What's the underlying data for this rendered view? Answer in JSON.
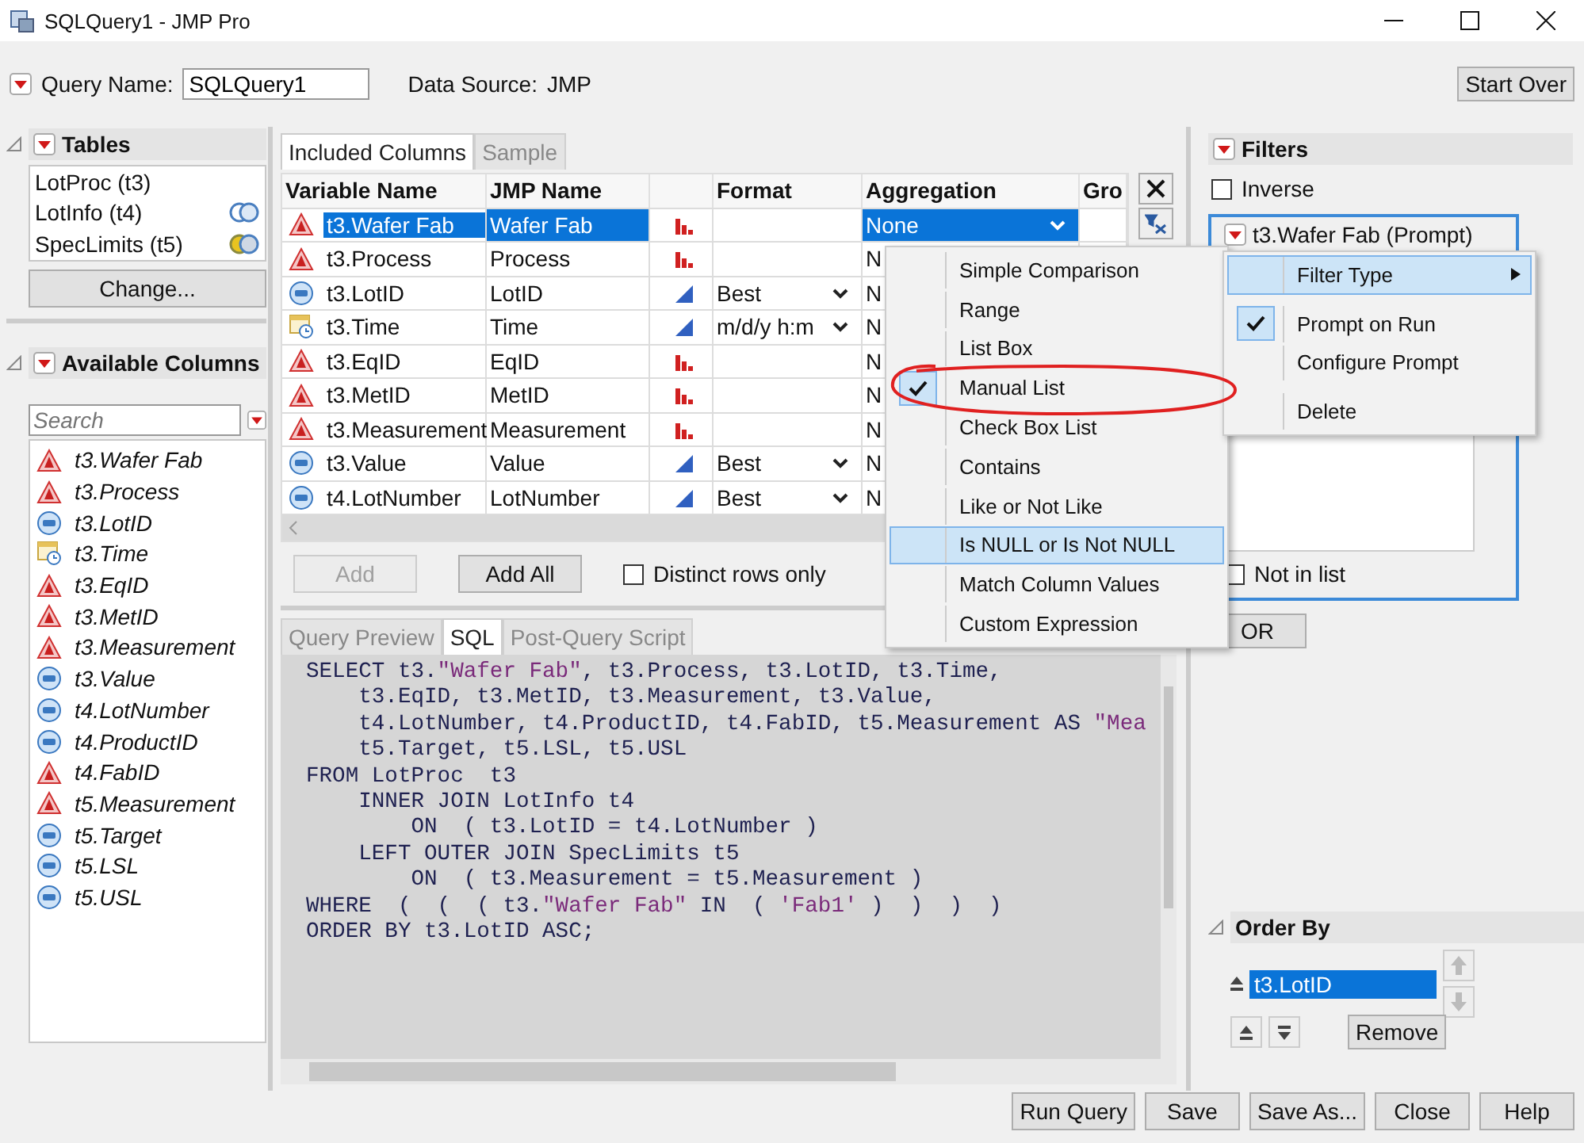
{
  "window": {
    "title": "SQLQuery1 - JMP Pro"
  },
  "query_name": {
    "label": "Query Name:",
    "value": "SQLQuery1"
  },
  "data_source": {
    "label": "Data Source:",
    "value": "JMP"
  },
  "start_over": "Start Over",
  "tables": {
    "title": "Tables",
    "items": [
      {
        "name": "LotProc (t3)",
        "kind": "base"
      },
      {
        "name": "LotInfo (t4)",
        "kind": "inner"
      },
      {
        "name": "SpecLimits (t5)",
        "kind": "outer"
      }
    ],
    "button": "Change..."
  },
  "available_columns": {
    "title": "Available Columns",
    "search_placeholder": "Search",
    "items": [
      {
        "name": "t3.Wafer Fab",
        "kind": "character"
      },
      {
        "name": "t3.Process",
        "kind": "character"
      },
      {
        "name": "t3.LotID",
        "kind": "numeric"
      },
      {
        "name": "t3.Time",
        "kind": "time"
      },
      {
        "name": "t3.EqID",
        "kind": "character"
      },
      {
        "name": "t3.MetID",
        "kind": "character"
      },
      {
        "name": "t3.Measurement",
        "kind": "character"
      },
      {
        "name": "t3.Value",
        "kind": "numeric"
      },
      {
        "name": "t4.LotNumber",
        "kind": "numeric"
      },
      {
        "name": "t4.ProductID",
        "kind": "numeric"
      },
      {
        "name": "t4.FabID",
        "kind": "character"
      },
      {
        "name": "t5.Measurement",
        "kind": "character"
      },
      {
        "name": "t5.Target",
        "kind": "numeric"
      },
      {
        "name": "t5.LSL",
        "kind": "numeric"
      },
      {
        "name": "t5.USL",
        "kind": "numeric"
      }
    ]
  },
  "included_tabs": [
    {
      "label": "Included Columns",
      "selected": true
    },
    {
      "label": "Sample",
      "selected": false
    }
  ],
  "table": {
    "headers": {
      "variable_name": "Variable Name",
      "jmp_name": "JMP Name",
      "format": "Format",
      "aggregation": "Aggregation",
      "column_6": "Gro"
    },
    "rows": [
      {
        "variable": "t3.Wafer Fab",
        "kind": "character",
        "jmp_name": "Wafer Fab",
        "aggregation": "None",
        "selected": true
      },
      {
        "variable": "t3.Process",
        "kind": "character",
        "jmp_name": "Process",
        "aggregation": "N",
        "selected": false
      },
      {
        "variable": "t3.LotID",
        "kind": "numeric",
        "jmp_name": "LotID",
        "format": "Best",
        "aggregation": "N",
        "selected": false
      },
      {
        "variable": "t3.Time",
        "kind": "time",
        "jmp_name": "Time",
        "format": "m/d/y h:m",
        "aggregation": "N",
        "selected": false
      },
      {
        "variable": "t3.EqID",
        "kind": "character",
        "jmp_name": "EqID",
        "aggregation": "N",
        "selected": false
      },
      {
        "variable": "t3.MetID",
        "kind": "character",
        "jmp_name": "MetID",
        "aggregation": "N",
        "selected": false
      },
      {
        "variable": "t3.Measurement",
        "kind": "character",
        "jmp_name": "Measurement",
        "aggregation": "N",
        "selected": false
      },
      {
        "variable": "t3.Value",
        "kind": "numeric",
        "jmp_name": "Value",
        "format": "Best",
        "aggregation": "N",
        "selected": false
      },
      {
        "variable": "t4.LotNumber",
        "kind": "numeric",
        "jmp_name": "LotNumber",
        "format": "Best",
        "aggregation": "N",
        "selected": false
      }
    ]
  },
  "add_buttons": [
    {
      "label": "Add",
      "disabled": true
    },
    {
      "label": "Add All",
      "disabled": false
    }
  ],
  "distinct_rows": {
    "label": "Distinct rows only",
    "checked": false
  },
  "preview_tabs": [
    {
      "label": "Query Preview",
      "selected": false
    },
    {
      "label": "SQL",
      "selected": true
    },
    {
      "label": "Post-Query Script",
      "selected": false
    }
  ],
  "sql": [
    [
      {
        "text": "SELECT t3.",
        "kind": "code"
      },
      {
        "text": "\"Wafer Fab\"",
        "kind": "string"
      },
      {
        "text": ", t3.Process, t3.LotID, t3.Time,",
        "kind": "code"
      }
    ],
    [
      {
        "text": "    t3.EqID, t3.MetID, t3.Measurement, t3.Value,",
        "kind": "code"
      }
    ],
    [
      {
        "text": "    t4.LotNumber, t4.ProductID, t4.FabID, t5.Measurement AS ",
        "kind": "code"
      },
      {
        "text": "\"Mea",
        "kind": "string"
      }
    ],
    [
      {
        "text": "    t5.Target, t5.LSL, t5.USL",
        "kind": "code"
      }
    ],
    [
      {
        "text": "FROM LotProc  t3",
        "kind": "code"
      }
    ],
    [
      {
        "text": "    INNER JOIN LotInfo t4",
        "kind": "code"
      }
    ],
    [
      {
        "text": "        ON  ( t3.LotID = t4.LotNumber )",
        "kind": "code"
      }
    ],
    [
      {
        "text": "    LEFT OUTER JOIN SpecLimits t5",
        "kind": "code"
      }
    ],
    [
      {
        "text": "        ON  ( t3.Measurement = t5.Measurement )",
        "kind": "code"
      }
    ],
    [
      {
        "text": "WHERE  (  (  ( t3.",
        "kind": "code"
      },
      {
        "text": "\"Wafer Fab\"",
        "kind": "string"
      },
      {
        "text": " IN  ( ",
        "kind": "code"
      },
      {
        "text": "'Fab1'",
        "kind": "string"
      },
      {
        "text": " )  )  )  )",
        "kind": "code"
      }
    ],
    [
      {
        "text": "ORDER BY t3.LotID ASC;",
        "kind": "code"
      }
    ]
  ],
  "filters": {
    "title": "Filters",
    "inverse": {
      "label": "Inverse",
      "checked": false
    },
    "filter": {
      "title": "t3.Wafer Fab (Prompt)",
      "not_in_list": {
        "label": "Not in list",
        "checked": false
      }
    },
    "or_button": "OR"
  },
  "order_by": {
    "title": "Order By",
    "items": [
      {
        "label": "t3.LotID",
        "selected": true
      }
    ],
    "remove": "Remove"
  },
  "filter_type_menu": [
    {
      "label": "Simple Comparison",
      "checked": false,
      "highlighted": false
    },
    {
      "label": "Range",
      "checked": false,
      "highlighted": false
    },
    {
      "label": "List Box",
      "checked": false,
      "highlighted": false
    },
    {
      "label": "Manual List",
      "checked": true,
      "highlighted": false
    },
    {
      "label": "Check Box List",
      "checked": false,
      "highlighted": false
    },
    {
      "label": "Contains",
      "checked": false,
      "highlighted": false
    },
    {
      "label": "Like or Not Like",
      "checked": false,
      "highlighted": false
    },
    {
      "label": "Is NULL or Is Not NULL",
      "checked": false,
      "highlighted": true
    },
    {
      "label": "Match Column Values",
      "checked": false,
      "highlighted": false
    },
    {
      "label": "Custom Expression",
      "checked": false,
      "highlighted": false
    }
  ],
  "filter_menu": [
    {
      "label": "Filter Type",
      "kind": "submenu",
      "checked": false,
      "highlighted": true
    },
    {
      "label": "Prompt on Run",
      "kind": "item",
      "checked": true,
      "highlighted": false
    },
    {
      "label": "Configure Prompt",
      "kind": "item",
      "checked": false,
      "highlighted": false
    },
    {
      "label": "Delete",
      "kind": "item",
      "checked": false,
      "highlighted": false
    }
  ],
  "bottom_buttons": [
    "Run Query",
    "Save",
    "Save As...",
    "Close",
    "Help"
  ]
}
